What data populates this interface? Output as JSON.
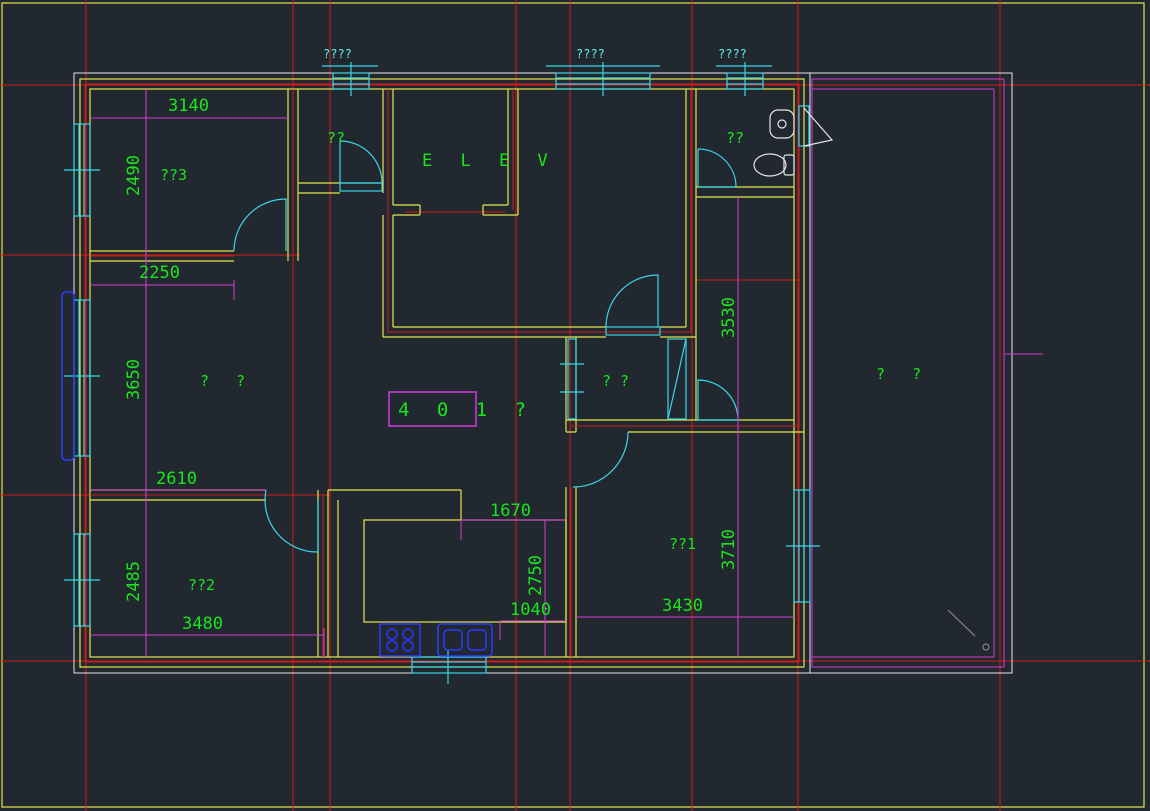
{
  "drawing": {
    "unit_label": "4 0 1 ?",
    "elevator_label": "E L E V",
    "rooms": {
      "bedroom3": "??3",
      "bedroom2": "??2",
      "bedroom1": "??1",
      "small_room_top": "??",
      "bath": "??",
      "living": "?   ?",
      "storage": "? ?",
      "balcony": "?   ?"
    },
    "window_tags": {
      "top_left": "????",
      "top_center": "????",
      "top_right": "????"
    },
    "dimensions": {
      "d3140": "3140",
      "d2490": "2490",
      "d2250": "2250",
      "d3650": "3650",
      "d2610": "2610",
      "d2485": "2485",
      "d3480": "3480",
      "d1670": "1670",
      "d2750": "2750",
      "d1040": "1040",
      "d3430": "3430",
      "d3710": "3710",
      "d3530": "3530"
    }
  },
  "colors": {
    "background": "#212830",
    "wall_yellow": "#e6e64a",
    "wall_red": "#c81e1e",
    "grid_red": "#d21a1a",
    "dimension_magenta": "#d23cd2",
    "door_cyan": "#3ad6e6",
    "text_green": "#19e619",
    "fixture_blue": "#2a3cff",
    "outline_white": "#e6e6e6"
  }
}
